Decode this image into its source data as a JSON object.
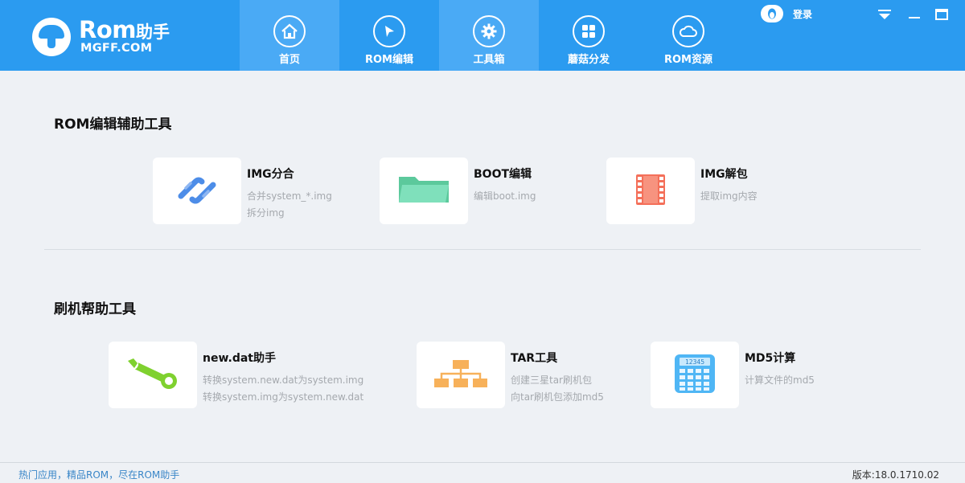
{
  "app": {
    "logo_main": "Rom",
    "logo_main_cn": "助手",
    "logo_sub": "MGFF.COM"
  },
  "nav": {
    "tabs": [
      {
        "label": "首页",
        "icon": "home-icon"
      },
      {
        "label": "ROM编辑",
        "icon": "cursor-icon"
      },
      {
        "label": "工具箱",
        "icon": "gear-icon"
      },
      {
        "label": "蘑菇分发",
        "icon": "grid-icon"
      },
      {
        "label": "ROM资源",
        "icon": "cloud-icon"
      }
    ],
    "selected_tab": "工具箱"
  },
  "header": {
    "login_label": "登录",
    "window_controls": [
      "dropdown-icon",
      "minimize-icon",
      "maximize-icon",
      "close-icon"
    ]
  },
  "sections": [
    {
      "title": "ROM编辑辅助工具",
      "tools": [
        {
          "title": "IMG分合",
          "desc": [
            "合并system_*.img",
            "拆分img"
          ],
          "icon": "link-icon",
          "color": "#4d8de8"
        },
        {
          "title": "BOOT编辑",
          "desc": [
            "编辑boot.img"
          ],
          "icon": "folder-icon",
          "color": "#6fd9b0"
        },
        {
          "title": "IMG解包",
          "desc": [
            "提取img内容"
          ],
          "icon": "film-icon",
          "color": "#f4705a"
        }
      ]
    },
    {
      "title": "刷机帮助工具",
      "tools": [
        {
          "title": "new.dat助手",
          "desc": [
            "转换system.new.dat为system.img",
            "转换system.img为system.new.dat"
          ],
          "icon": "wrench-icon",
          "color": "#7fd12f"
        },
        {
          "title": "TAR工具",
          "desc": [
            "创建三星tar刷机包",
            "向tar刷机包添加md5"
          ],
          "icon": "hierarchy-icon",
          "color": "#f7b15a"
        },
        {
          "title": "MD5计算",
          "desc": [
            "计算文件的md5"
          ],
          "icon": "calculator-icon",
          "color": "#4fb6f5",
          "icon_text": "12345"
        }
      ]
    }
  ],
  "footer": {
    "slogan": "热门应用，精品ROM，尽在ROM助手",
    "version": "版本:18.0.1710.02"
  },
  "colors": {
    "header_bg": "#2b9bf0",
    "tab_highlight": "#4aaaf5",
    "page_bg": "#eef1f5",
    "slogan": "#3a86c8"
  }
}
